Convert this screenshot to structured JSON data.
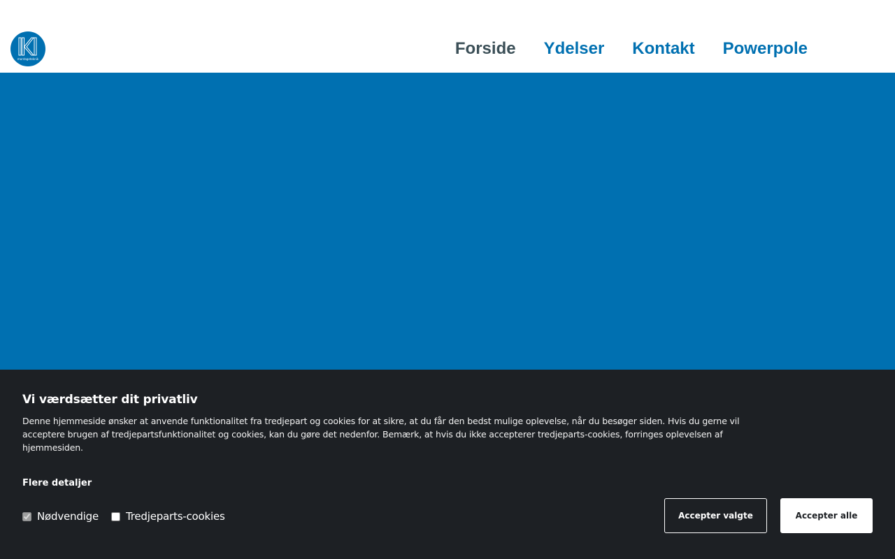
{
  "header": {
    "logo_text": "montageteknik",
    "nav": [
      {
        "label": "Forside",
        "active": true
      },
      {
        "label": "Ydelser",
        "active": false
      },
      {
        "label": "Kontakt",
        "active": false
      },
      {
        "label": "Powerpole",
        "active": false
      }
    ]
  },
  "colors": {
    "brand_blue": "#0070b1",
    "nav_active": "#3b4f57",
    "banner_bg": "#1d2024"
  },
  "cookie_banner": {
    "title": "Vi værdsætter dit privatliv",
    "text": "Denne hjemmeside ønsker at anvende funktionalitet fra tredjepart og cookies for at sikre, at du får den bedst mulige oplevelse, når du besøger siden. Hvis du gerne vil acceptere brugen af tredjepartsfunktionalitet og cookies, kan du gøre det nedenfor. Bemærk, at hvis du ikke accepterer tredjeparts-cookies, forringes oplevelsen af hjemmesiden.",
    "more_details": "Flere detaljer",
    "checkbox_necessary": "Nødvendige",
    "checkbox_third_party": "Tredjeparts-cookies",
    "accept_selected": "Accepter valgte",
    "accept_all": "Accepter alle"
  }
}
